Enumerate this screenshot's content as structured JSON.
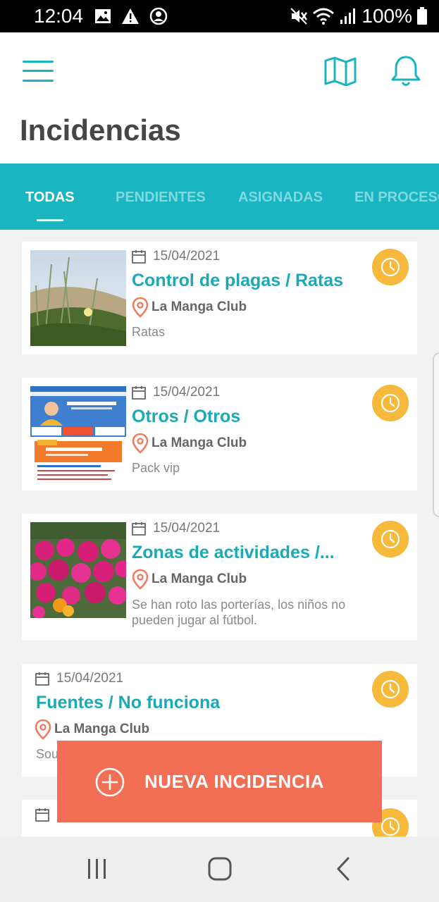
{
  "status_bar": {
    "time": "12:04",
    "battery": "100%",
    "left_icons": [
      "image-icon",
      "warning-icon",
      "account-circle-icon"
    ],
    "right_icons": [
      "mute-icon",
      "wifi-icon",
      "signal-icon",
      "battery-icon"
    ]
  },
  "header": {
    "title": "Incidencias",
    "menu_icon": "hamburger-menu-icon",
    "map_icon": "map-icon",
    "notification_icon": "bell-icon"
  },
  "tabs": [
    {
      "label": "TODAS",
      "active": true
    },
    {
      "label": "PENDIENTES",
      "active": false
    },
    {
      "label": "ASIGNADAS",
      "active": false
    },
    {
      "label": "EN PROCESO",
      "active": false
    }
  ],
  "incidents": [
    {
      "date": "15/04/2021",
      "title": "Control de plagas / Ratas",
      "location": "La Manga Club",
      "description": "Ratas",
      "status_icon": "clock-icon"
    },
    {
      "date": "15/04/2021",
      "title": "Otros / Otros",
      "location": "La Manga Club",
      "description": "Pack vip",
      "status_icon": "clock-icon"
    },
    {
      "date": "15/04/2021",
      "title": "Zonas de actividades /...",
      "location": "La Manga Club",
      "description_lines": [
        "Se han roto las porterías, los niños no",
        "pueden jugar al fútbol."
      ],
      "status_icon": "clock-icon"
    },
    {
      "date": "15/04/2021",
      "title": "Fuentes / No funciona",
      "location": "La Manga Club",
      "description": "Sou",
      "status_icon": "clock-icon"
    }
  ],
  "fab": {
    "label": "NUEVA INCIDENCIA",
    "icon": "plus-circle-icon"
  },
  "colors": {
    "accent": "#1ab5c1",
    "title_text": "#19aab6",
    "fab": "#f26f55",
    "status_pending": "#f6b93b",
    "location_pin": "#ee7b62"
  },
  "nav": [
    "recents-icon",
    "home-icon",
    "back-icon"
  ]
}
